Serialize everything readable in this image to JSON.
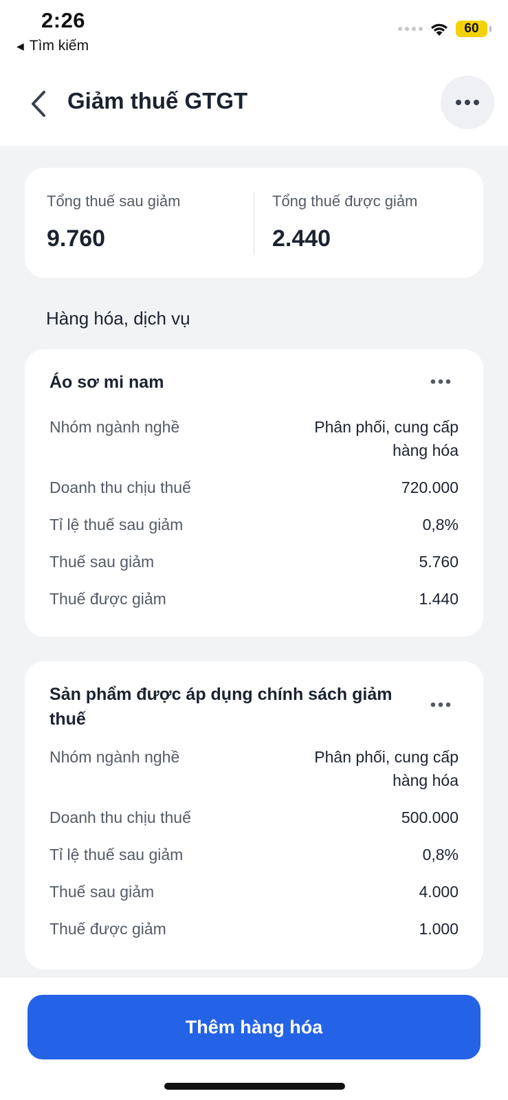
{
  "status_bar": {
    "time": "2:26",
    "back_app": "Tìm kiếm",
    "battery": "60"
  },
  "header": {
    "title": "Giảm thuế GTGT"
  },
  "summary": {
    "after_label": "Tổng thuế sau giảm",
    "after_value": "9.760",
    "reduced_label": "Tổng thuế được giảm",
    "reduced_value": "2.440"
  },
  "section_title": "Hàng hóa, dịch vụ",
  "items": [
    {
      "name": "Áo sơ mi nam",
      "rows": [
        {
          "label": "Nhóm ngành nghề",
          "value_line1": "Phân phối, cung cấp",
          "value_line2": "hàng hóa"
        },
        {
          "label": "Doanh thu chịu thuế",
          "value": "720.000"
        },
        {
          "label": "Tỉ lệ thuế sau giảm",
          "value": "0,8%"
        },
        {
          "label": "Thuế sau giảm",
          "value": "5.760"
        },
        {
          "label": "Thuế được giảm",
          "value": "1.440"
        }
      ]
    },
    {
      "name": "Sản phẩm được áp dụng chính sách giảm thuế",
      "rows": [
        {
          "label": "Nhóm ngành nghề",
          "value_line1": "Phân phối, cung cấp",
          "value_line2": "hàng hóa"
        },
        {
          "label": "Doanh thu chịu thuế",
          "value": "500.000"
        },
        {
          "label": "Tỉ lệ thuế sau giảm",
          "value": "0,8%"
        },
        {
          "label": "Thuế sau giảm",
          "value": "4.000"
        },
        {
          "label": "Thuế được giảm",
          "value": "1.000"
        }
      ]
    }
  ],
  "add_button": "Thêm hàng hóa",
  "colors": {
    "primary": "#2563e6",
    "background": "#f2f3f5",
    "text": "#1b2230",
    "muted": "#545b66"
  }
}
